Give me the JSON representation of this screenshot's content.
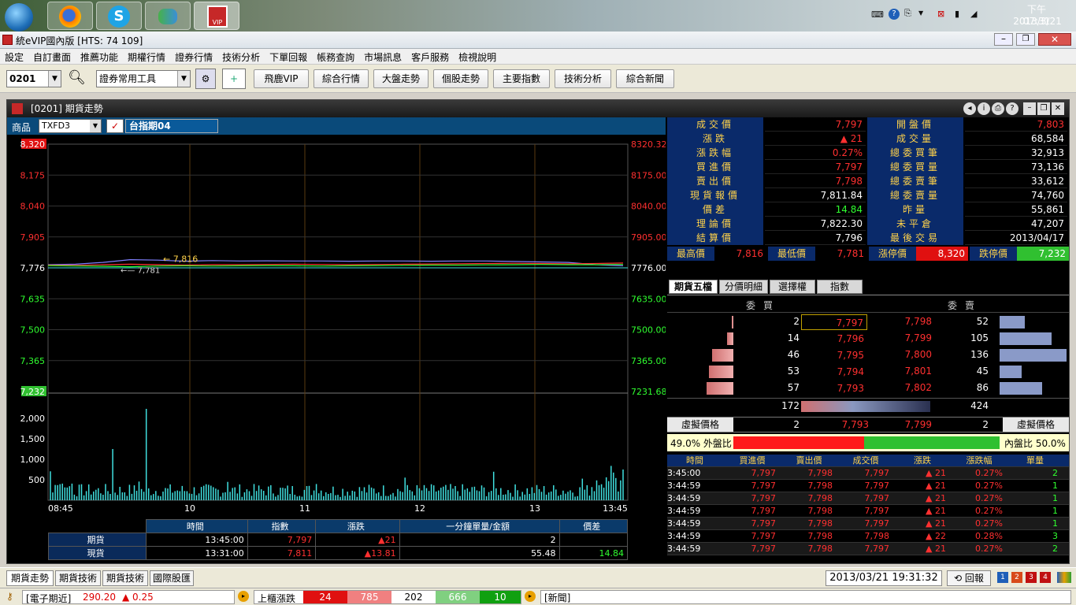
{
  "taskbar": {
    "time": "下午 07:31",
    "date": "2013/3/21"
  },
  "window": {
    "title": "統eVIP國內版 [HTS: 74 109]"
  },
  "menu": [
    "設定",
    "自訂畫面",
    "推薦功能",
    "期權行情",
    "證券行情",
    "技術分析",
    "下單回報",
    "帳務查詢",
    "市場訊息",
    "客戶服務",
    "檢視說明"
  ],
  "toolbar": {
    "code": "0201",
    "tools_combo": "證券常用工具",
    "buttons": [
      "飛鹿VIP",
      "綜合行情",
      "大盤走勢",
      "個股走勢",
      "主要指數",
      "技術分析",
      "綜合新聞"
    ]
  },
  "panel": {
    "title": "[0201] 期貨走勢",
    "product_label": "商品",
    "product_code": "TXFD3",
    "product_name": "台指期04"
  },
  "chart_data": {
    "type": "line",
    "x_ticks": [
      "08:45",
      "10",
      "11",
      "12",
      "13",
      "13:45"
    ],
    "price_left_ticks": [
      "8,320",
      "8,175",
      "8,040",
      "7,905",
      "7,776",
      "7,635",
      "7,500",
      "7,365",
      "7,232"
    ],
    "price_right_ticks": [
      "8320.32",
      "8175.00",
      "8040.00",
      "7905.00",
      "7776.00",
      "7635.00",
      "7500.00",
      "7365.00",
      "7231.68"
    ],
    "volume_ticks": [
      "2,000",
      "1,500",
      "1,000",
      "500"
    ],
    "ylim": [
      7232,
      8320
    ],
    "reference": 7776,
    "annotations": [
      {
        "label": "7,816"
      },
      {
        "label": "7,781"
      }
    ],
    "series": [
      {
        "color": "#8080ff",
        "values": [
          7790,
          7792,
          7800,
          7812,
          7810,
          7805,
          7808,
          7806,
          7807,
          7806,
          7806,
          7805,
          7806,
          7806,
          7805,
          7806,
          7806,
          7804,
          7802,
          7800,
          7790,
          7785
        ]
      },
      {
        "color": "#ff3030",
        "values": [
          7788,
          7787,
          7790,
          7792,
          7790,
          7788,
          7790,
          7790,
          7791,
          7792,
          7791,
          7790,
          7791,
          7792,
          7793,
          7794,
          7795,
          7796,
          7795,
          7794,
          7795,
          7797
        ]
      },
      {
        "color": "#30ff30",
        "values": [
          7786,
          7784,
          7783,
          7781,
          7784,
          7785,
          7784,
          7785,
          7786,
          7785,
          7784,
          7785,
          7786,
          7787,
          7788,
          7788,
          7789,
          7790,
          7791,
          7790,
          7790,
          7791
        ]
      }
    ],
    "volume_max": 2500
  },
  "summary": {
    "headers": [
      "時間",
      "指數",
      "漲跌",
      "一分鐘單量/金額",
      "價差"
    ],
    "rows": [
      {
        "label": "期貨",
        "time": "13:45:00",
        "index": "7,797",
        "change": "▲21",
        "vol": "2",
        "spread": ""
      },
      {
        "label": "現貨",
        "time": "13:31:00",
        "index": "7,811",
        "change": "▲13.81",
        "vol": "55.48",
        "spread": "14.84"
      }
    ]
  },
  "quote": {
    "left": [
      {
        "label": "成交價",
        "value": "7,797",
        "color": "red"
      },
      {
        "label": "漲跌",
        "value": "▲ 21",
        "color": "red"
      },
      {
        "label": "漲跌幅",
        "value": "0.27%",
        "color": "red"
      },
      {
        "label": "買進價",
        "value": "7,797",
        "color": "red"
      },
      {
        "label": "賣出價",
        "value": "7,798",
        "color": "red"
      },
      {
        "label": "現貨報價",
        "value": "7,811.84",
        "color": "white"
      },
      {
        "label": "價差",
        "value": "14.84",
        "color": "green"
      },
      {
        "label": "理論價",
        "value": "7,822.30",
        "color": "white"
      },
      {
        "label": "結算價",
        "value": "7,796",
        "color": "white"
      }
    ],
    "right": [
      {
        "label": "開盤價",
        "value": "7,803",
        "color": "red"
      },
      {
        "label": "成交量",
        "value": "68,584",
        "color": "white"
      },
      {
        "label": "總委買筆",
        "value": "32,913",
        "color": "white"
      },
      {
        "label": "總委買量",
        "value": "73,136",
        "color": "white"
      },
      {
        "label": "總委賣筆",
        "value": "33,612",
        "color": "white"
      },
      {
        "label": "總委賣量",
        "value": "74,760",
        "color": "white"
      },
      {
        "label": "昨量",
        "value": "55,861",
        "color": "white"
      },
      {
        "label": "未平倉",
        "value": "47,207",
        "color": "white"
      },
      {
        "label": "最後交易",
        "value": "2013/04/17",
        "color": "white"
      }
    ],
    "highlow": [
      {
        "label": "最高價",
        "value": "7,816"
      },
      {
        "label": "最低價",
        "value": "7,781"
      },
      {
        "label": "漲停價",
        "value": "8,320"
      },
      {
        "label": "跌停價",
        "value": "7,232"
      }
    ]
  },
  "tabs": [
    "期貨五檔",
    "分價明細",
    "選擇權",
    "指數"
  ],
  "book": {
    "bid_header": "委買",
    "ask_header": "委賣",
    "rows": [
      {
        "bq": "2",
        "bp": "7,797",
        "ap": "7,798",
        "aq": "52",
        "bw": 0.02,
        "aw": 0.22
      },
      {
        "bq": "14",
        "bp": "7,796",
        "ap": "7,799",
        "aq": "105",
        "bw": 0.1,
        "aw": 0.45
      },
      {
        "bq": "46",
        "bp": "7,795",
        "ap": "7,800",
        "aq": "136",
        "bw": 0.34,
        "aw": 0.58
      },
      {
        "bq": "53",
        "bp": "7,794",
        "ap": "7,801",
        "aq": "45",
        "bw": 0.39,
        "aw": 0.19
      },
      {
        "bq": "57",
        "bp": "7,793",
        "ap": "7,802",
        "aq": "86",
        "bw": 0.42,
        "aw": 0.37
      }
    ],
    "bid_total": "172",
    "ask_total": "424",
    "virtual_label": "虛擬價格",
    "virtual": {
      "bq": "2",
      "bp": "7,793",
      "ap": "7,799",
      "aq": "2"
    },
    "outer_ratio_text": "49.0% 外盤比",
    "inner_ratio_text": "內盤比 50.0%",
    "outer_ratio": 0.49
  },
  "ticks": {
    "headers": [
      "時間",
      "買進價",
      "賣出價",
      "成交價",
      "漲跌",
      "漲跌幅",
      "單量"
    ],
    "rows": [
      [
        "3:45:00",
        "7,797",
        "7,798",
        "7,797",
        "▲ 21",
        "0.27%",
        "2"
      ],
      [
        "3:44:59",
        "7,797",
        "7,798",
        "7,797",
        "▲ 21",
        "0.27%",
        "1"
      ],
      [
        "3:44:59",
        "7,797",
        "7,798",
        "7,797",
        "▲ 21",
        "0.27%",
        "1"
      ],
      [
        "3:44:59",
        "7,797",
        "7,798",
        "7,797",
        "▲ 21",
        "0.27%",
        "1"
      ],
      [
        "3:44:59",
        "7,797",
        "7,798",
        "7,797",
        "▲ 21",
        "0.27%",
        "1"
      ],
      [
        "3:44:59",
        "7,797",
        "7,798",
        "7,798",
        "▲ 22",
        "0.28%",
        "3"
      ],
      [
        "3:44:59",
        "7,797",
        "7,798",
        "7,797",
        "▲ 21",
        "0.27%",
        "2"
      ]
    ]
  },
  "bottom_tabs": [
    "期貨走勢",
    "期貨技術",
    "期貨技術",
    "國際股匯"
  ],
  "datetime": "2013/03/21 19:31:32",
  "reply_btn": "回報",
  "ticker": {
    "item": "[電子期近]",
    "price": "290.20",
    "change": "▲ 0.25",
    "otc_label": "上櫃漲跌",
    "vals": [
      "24",
      "785",
      "202",
      "666",
      "10"
    ],
    "news": "[新聞]"
  }
}
